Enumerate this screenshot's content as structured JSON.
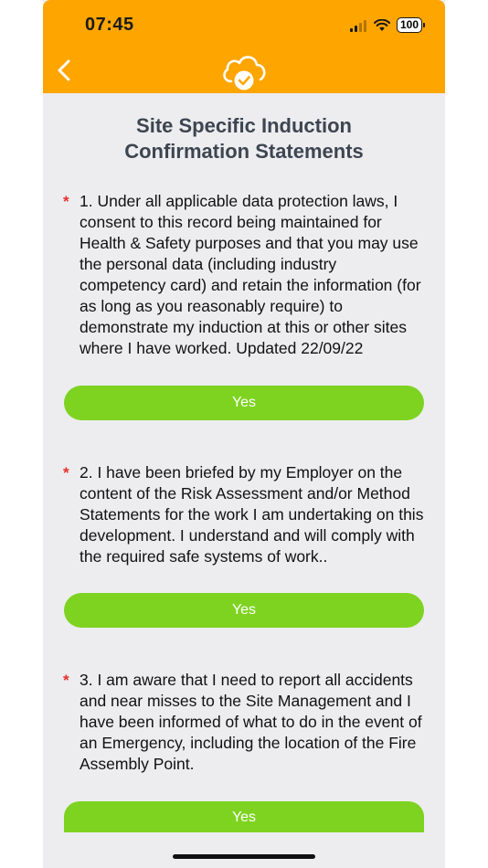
{
  "status_bar": {
    "time": "07:45",
    "battery": "100"
  },
  "header": {
    "logo_icon": "cloud-check-icon",
    "back_icon": "chevron-left-icon",
    "background": "#ffa500"
  },
  "page": {
    "title_line1": "Site Specific Induction",
    "title_line2": "Confirmation Statements"
  },
  "statements": [
    {
      "marker": "*",
      "text": "1. Under all applicable data protection laws, I consent to this record being maintained for Health & Safety purposes and that you may use the personal data (including industry competency card) and retain the information (for as long as you reasonably require) to demonstrate my induction at this or other  sites where I have worked. Updated 22/09/22",
      "button_label": "Yes"
    },
    {
      "marker": "*",
      "text": "2. I have been briefed by my Employer on the content of the Risk Assessment and/or Method Statements for the work I am undertaking on this development. I understand and will comply with the required safe systems of work..",
      "button_label": "Yes"
    },
    {
      "marker": "*",
      "text": "3. I am aware that I need to report all accidents and near misses to the Site Management and I have been informed of what to do in the event of an Emergency, including the location of the Fire Assembly Point.",
      "button_label": "Yes"
    }
  ],
  "colors": {
    "accent_orange": "#ffa500",
    "button_green": "#7ed321",
    "required_red": "#e4312b"
  }
}
